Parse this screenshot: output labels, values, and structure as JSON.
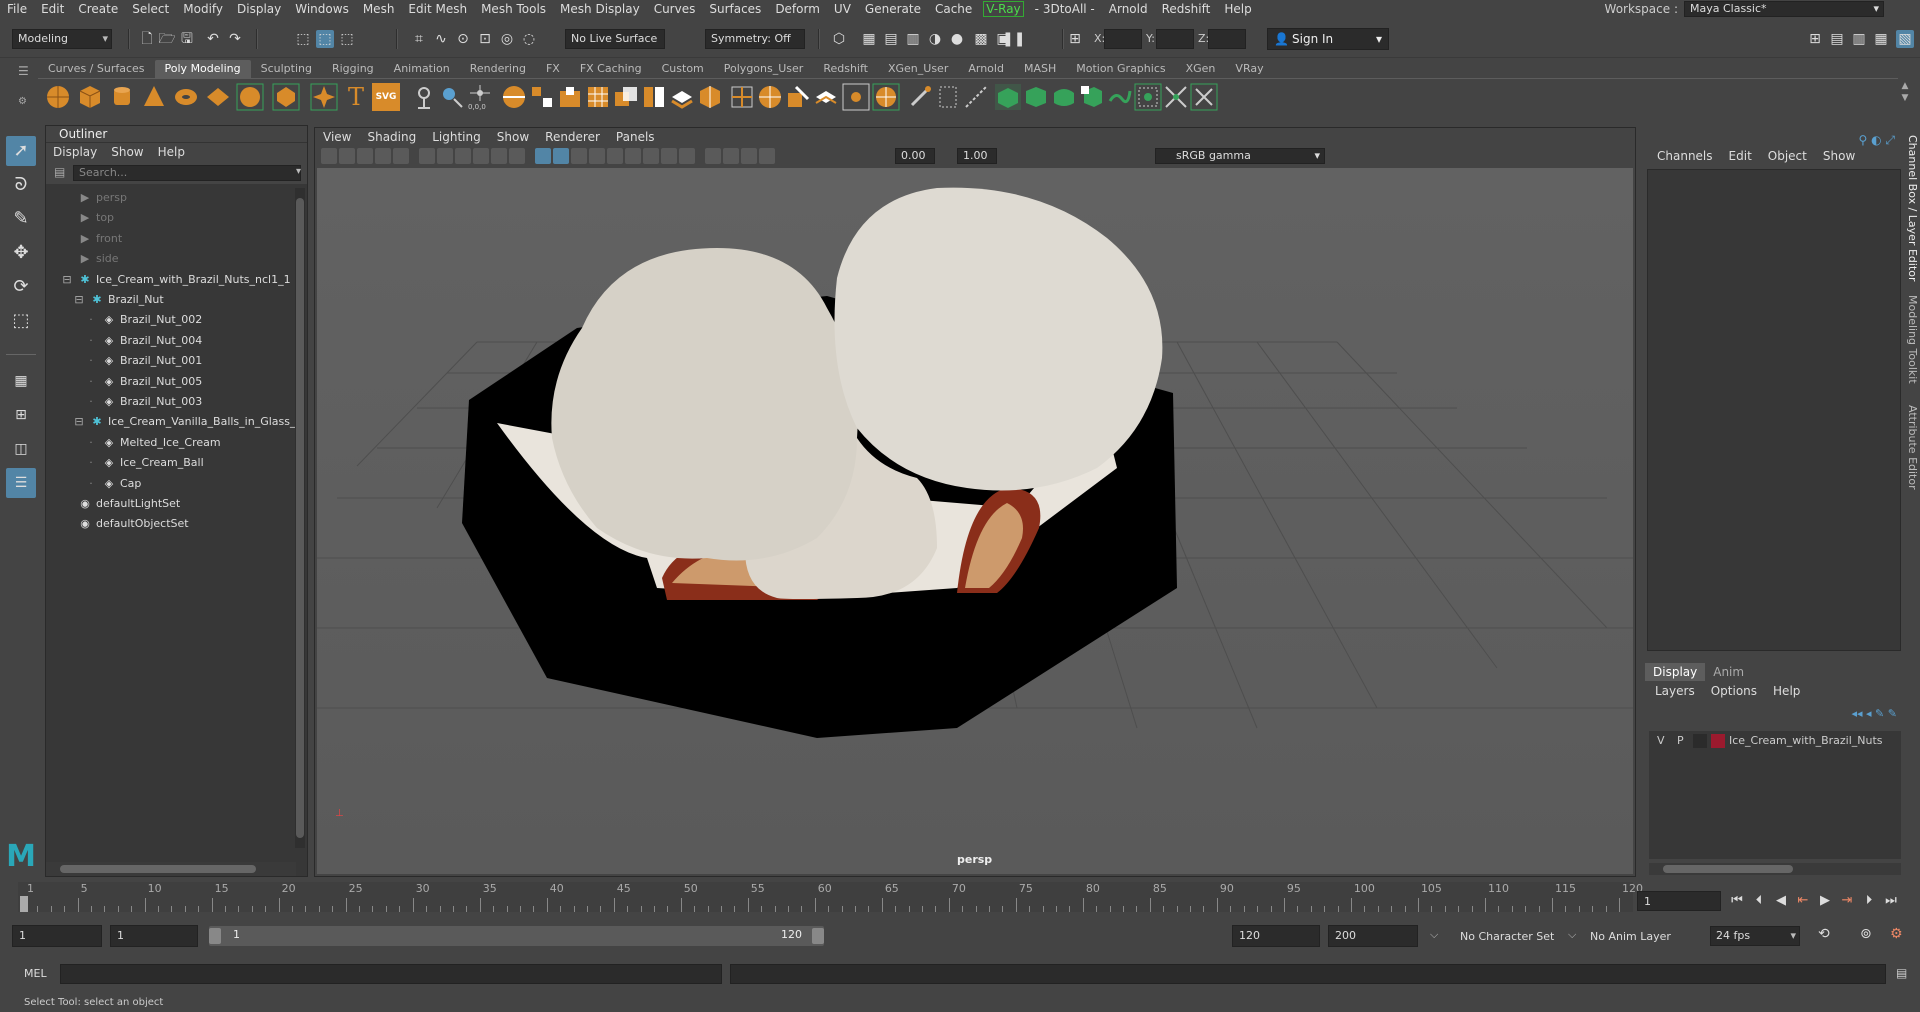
{
  "menubar": {
    "items": [
      "File",
      "Edit",
      "Create",
      "Select",
      "Modify",
      "Display",
      "Windows",
      "Mesh",
      "Edit Mesh",
      "Mesh Tools",
      "Mesh Display",
      "Curves",
      "Surfaces",
      "Deform",
      "UV",
      "Generate",
      "Cache",
      "V-Ray",
      "- 3DtoAll -",
      "Arnold",
      "Redshift",
      "Help"
    ],
    "workspace_label": "Workspace :",
    "workspace_value": "Maya Classic*"
  },
  "statusline": {
    "mode": "Modeling",
    "live_surface": "No Live Surface",
    "symmetry": "Symmetry: Off",
    "x_label": "X:",
    "y_label": "Y:",
    "z_label": "Z:",
    "sign_in": "Sign In"
  },
  "shelf": {
    "tabs": [
      "Curves / Surfaces",
      "Poly Modeling",
      "Sculpting",
      "Rigging",
      "Animation",
      "Rendering",
      "FX",
      "FX Caching",
      "Custom",
      "Polygons_User",
      "Redshift",
      "XGen_User",
      "Arnold",
      "MASH",
      "Motion Graphics",
      "XGen",
      "VRay"
    ],
    "active_tab": 1,
    "icon_text_t": "T",
    "icon_text_svg": "SVG"
  },
  "outliner": {
    "title": "Outliner",
    "menu": [
      "Display",
      "Show",
      "Help"
    ],
    "search_placeholder": "Search...",
    "rows": [
      {
        "label": "persp",
        "indent": 0,
        "icon": "camera",
        "dim": true
      },
      {
        "label": "top",
        "indent": 0,
        "icon": "camera",
        "dim": true
      },
      {
        "label": "front",
        "indent": 0,
        "icon": "camera",
        "dim": true
      },
      {
        "label": "side",
        "indent": 0,
        "icon": "camera",
        "dim": true
      },
      {
        "label": "Ice_Cream_with_Brazil_Nuts_ncl1_1",
        "indent": 0,
        "icon": "group",
        "dim": false,
        "expand": "-"
      },
      {
        "label": "Brazil_Nut",
        "indent": 1,
        "icon": "group",
        "dim": false,
        "expand": "-"
      },
      {
        "label": "Brazil_Nut_002",
        "indent": 2,
        "icon": "mesh",
        "dim": false
      },
      {
        "label": "Brazil_Nut_004",
        "indent": 2,
        "icon": "mesh",
        "dim": false
      },
      {
        "label": "Brazil_Nut_001",
        "indent": 2,
        "icon": "mesh",
        "dim": false
      },
      {
        "label": "Brazil_Nut_005",
        "indent": 2,
        "icon": "mesh",
        "dim": false
      },
      {
        "label": "Brazil_Nut_003",
        "indent": 2,
        "icon": "mesh",
        "dim": false
      },
      {
        "label": "Ice_Cream_Vanilla_Balls_in_Glass_B",
        "indent": 1,
        "icon": "group",
        "dim": false,
        "expand": "-"
      },
      {
        "label": "Melted_Ice_Cream",
        "indent": 2,
        "icon": "mesh",
        "dim": false
      },
      {
        "label": "Ice_Cream_Ball",
        "indent": 2,
        "icon": "mesh",
        "dim": false
      },
      {
        "label": "Cap",
        "indent": 2,
        "icon": "mesh",
        "dim": false
      },
      {
        "label": "defaultLightSet",
        "indent": 0,
        "icon": "set",
        "dim": false
      },
      {
        "label": "defaultObjectSet",
        "indent": 0,
        "icon": "set",
        "dim": false
      }
    ]
  },
  "viewport": {
    "menu": [
      "View",
      "Shading",
      "Lighting",
      "Show",
      "Renderer",
      "Panels"
    ],
    "exposure": "0.00",
    "gamma": "1.00",
    "color_space": "sRGB gamma",
    "camera": "persp"
  },
  "channelbox": {
    "menu": [
      "Channels",
      "Edit",
      "Object",
      "Show"
    ]
  },
  "side_tabs": [
    "Channel Box / Layer Editor",
    "Modeling Toolkit",
    "Attribute Editor"
  ],
  "layer_editor": {
    "tabs": [
      "Display",
      "Anim"
    ],
    "menu": [
      "Layers",
      "Options",
      "Help"
    ],
    "row": {
      "v": "V",
      "p": "P",
      "name": "Ice_Cream_with_Brazil_Nuts",
      "color": "#9b1a2e"
    }
  },
  "timeslider": {
    "labels": [
      "1",
      "5",
      "10",
      "15",
      "20",
      "25",
      "30",
      "35",
      "40",
      "45",
      "50",
      "55",
      "60",
      "65",
      "70",
      "75",
      "80",
      "85",
      "90",
      "95",
      "100",
      "105",
      "110",
      "115",
      "120"
    ],
    "current_frame": "1"
  },
  "range": {
    "start": "1",
    "playback_start": "1",
    "slider_start": "1",
    "slider_end": "120",
    "playback_end": "120",
    "end": "200",
    "character_set": "No Character Set",
    "anim_layer": "No Anim Layer",
    "fps": "24 fps"
  },
  "cmdline": {
    "lang": "MEL"
  },
  "helpline": {
    "text": "Select Tool: select an object"
  },
  "colors": {
    "accent": "#5285a6",
    "orange": "#d88b2a",
    "green": "#36a25a"
  }
}
